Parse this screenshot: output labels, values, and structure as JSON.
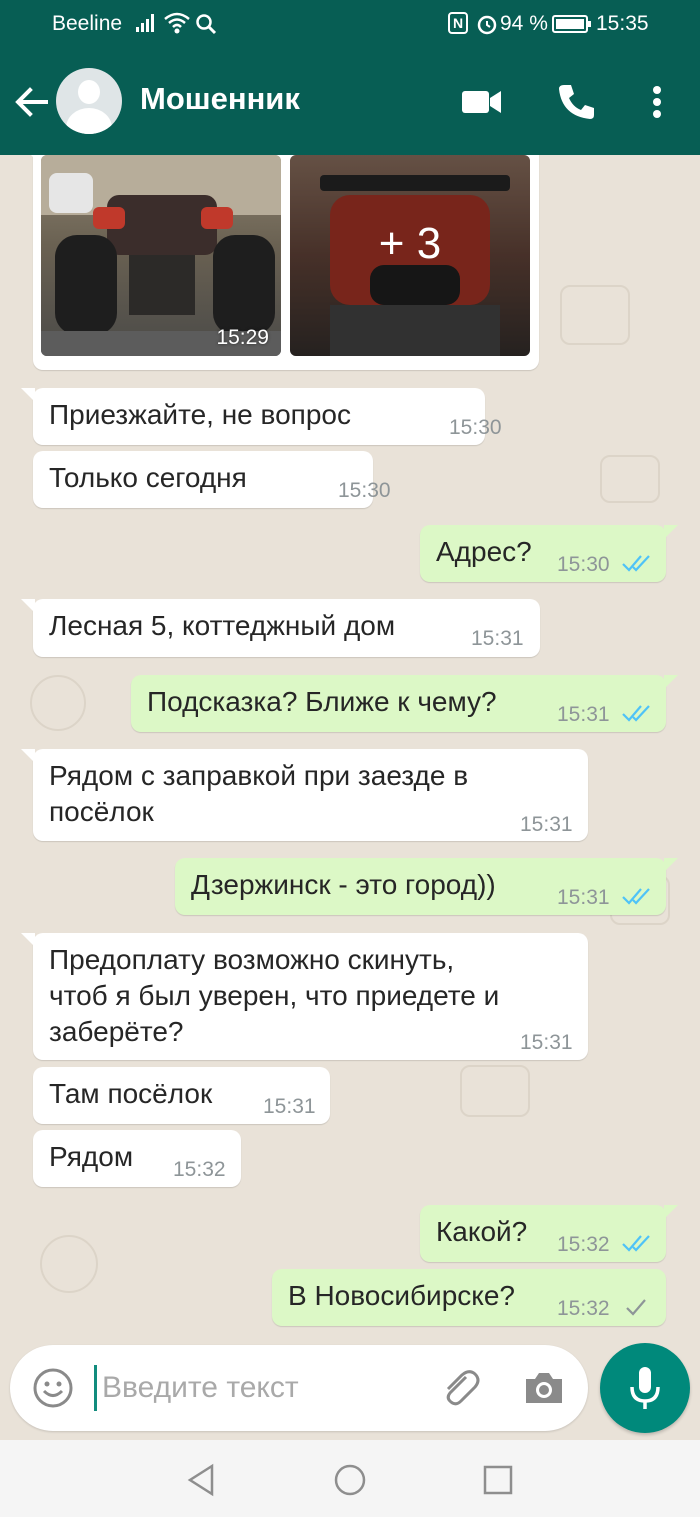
{
  "status_bar": {
    "carrier": "Beeline",
    "battery": "94 %",
    "clock": "15:35",
    "nfc": "N"
  },
  "header": {
    "contact_name": "Мошенник",
    "icons": [
      "back-arrow-icon",
      "avatar",
      "video-camera-icon",
      "phone-icon",
      "more-vert-icon"
    ]
  },
  "media": {
    "time": "15:29",
    "more_count": "+ 3"
  },
  "messages": [
    {
      "dir": "in",
      "text": "Приезжайте, не вопрос",
      "time": "15:30"
    },
    {
      "dir": "in",
      "text": "Только сегодня",
      "time": "15:30"
    },
    {
      "dir": "out",
      "text": "Адрес?",
      "time": "15:30",
      "status": "read"
    },
    {
      "dir": "in",
      "text": "Лесная 5, коттеджный дом",
      "time": "15:31"
    },
    {
      "dir": "out",
      "text": "Подсказка? Ближе к чему?",
      "time": "15:31",
      "status": "read"
    },
    {
      "dir": "in",
      "text": "Рядом с заправкой при заезде в\nпосёлок",
      "time": "15:31"
    },
    {
      "dir": "out",
      "text": "Дзержинск - это город))",
      "time": "15:31",
      "status": "read"
    },
    {
      "dir": "in",
      "text": "Предоплату возможно скинуть,\nчтоб я был уверен, что приедете и\nзаберёте?",
      "time": "15:31"
    },
    {
      "dir": "in",
      "text": "Там посёлок",
      "time": "15:31"
    },
    {
      "dir": "in",
      "text": "Рядом",
      "time": "15:32"
    },
    {
      "dir": "out",
      "text": "Какой?",
      "time": "15:32",
      "status": "read"
    },
    {
      "dir": "out",
      "text": "В Новосибирске?",
      "time": "15:32",
      "status": "sent"
    }
  ],
  "composer": {
    "placeholder": "Введите текст",
    "value": ""
  },
  "colors": {
    "header": "#075e54",
    "chat_bg": "#e9e2d8",
    "bubble_out": "#dcf8c6",
    "bubble_in": "#ffffff",
    "read_ticks": "#4fc3f7",
    "mic_button": "#00897b"
  }
}
